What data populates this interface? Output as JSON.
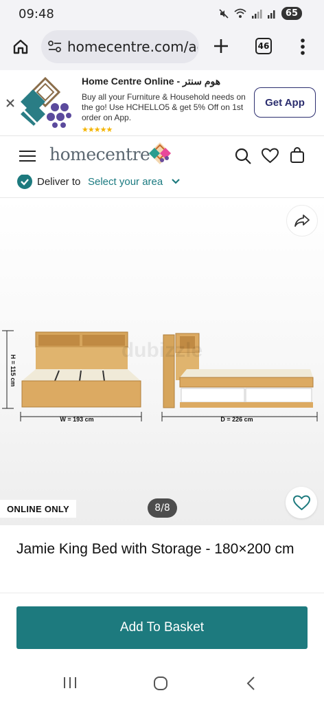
{
  "status_bar": {
    "time": "09:48",
    "battery": "65"
  },
  "browser": {
    "url": "homecentre.com/ae/",
    "tab_count": "46"
  },
  "app_banner": {
    "title": "Home Centre Online - هوم سنتر",
    "description": "Buy all your Furniture & Household needs on the go! Use HCHELLO5 & get 5% Off on 1st order on App.",
    "stars": "★★★★★",
    "cta": "Get App"
  },
  "site": {
    "logo": "homecentre",
    "deliver_label": "Deliver to",
    "deliver_area": "Select your area"
  },
  "gallery": {
    "badge": "ONLINE ONLY",
    "counter": "8/8",
    "height_label": "H = 115 cm",
    "width_label": "W = 193 cm",
    "depth_label": "D = 226 cm",
    "watermark": "dubizzle"
  },
  "product": {
    "title": "Jamie King Bed with Storage - 180×200 cm",
    "add_to_basket": "Add To Basket"
  },
  "colors": {
    "brand_teal": "#1d7a7e",
    "banner_navy": "#2b2d6e"
  }
}
